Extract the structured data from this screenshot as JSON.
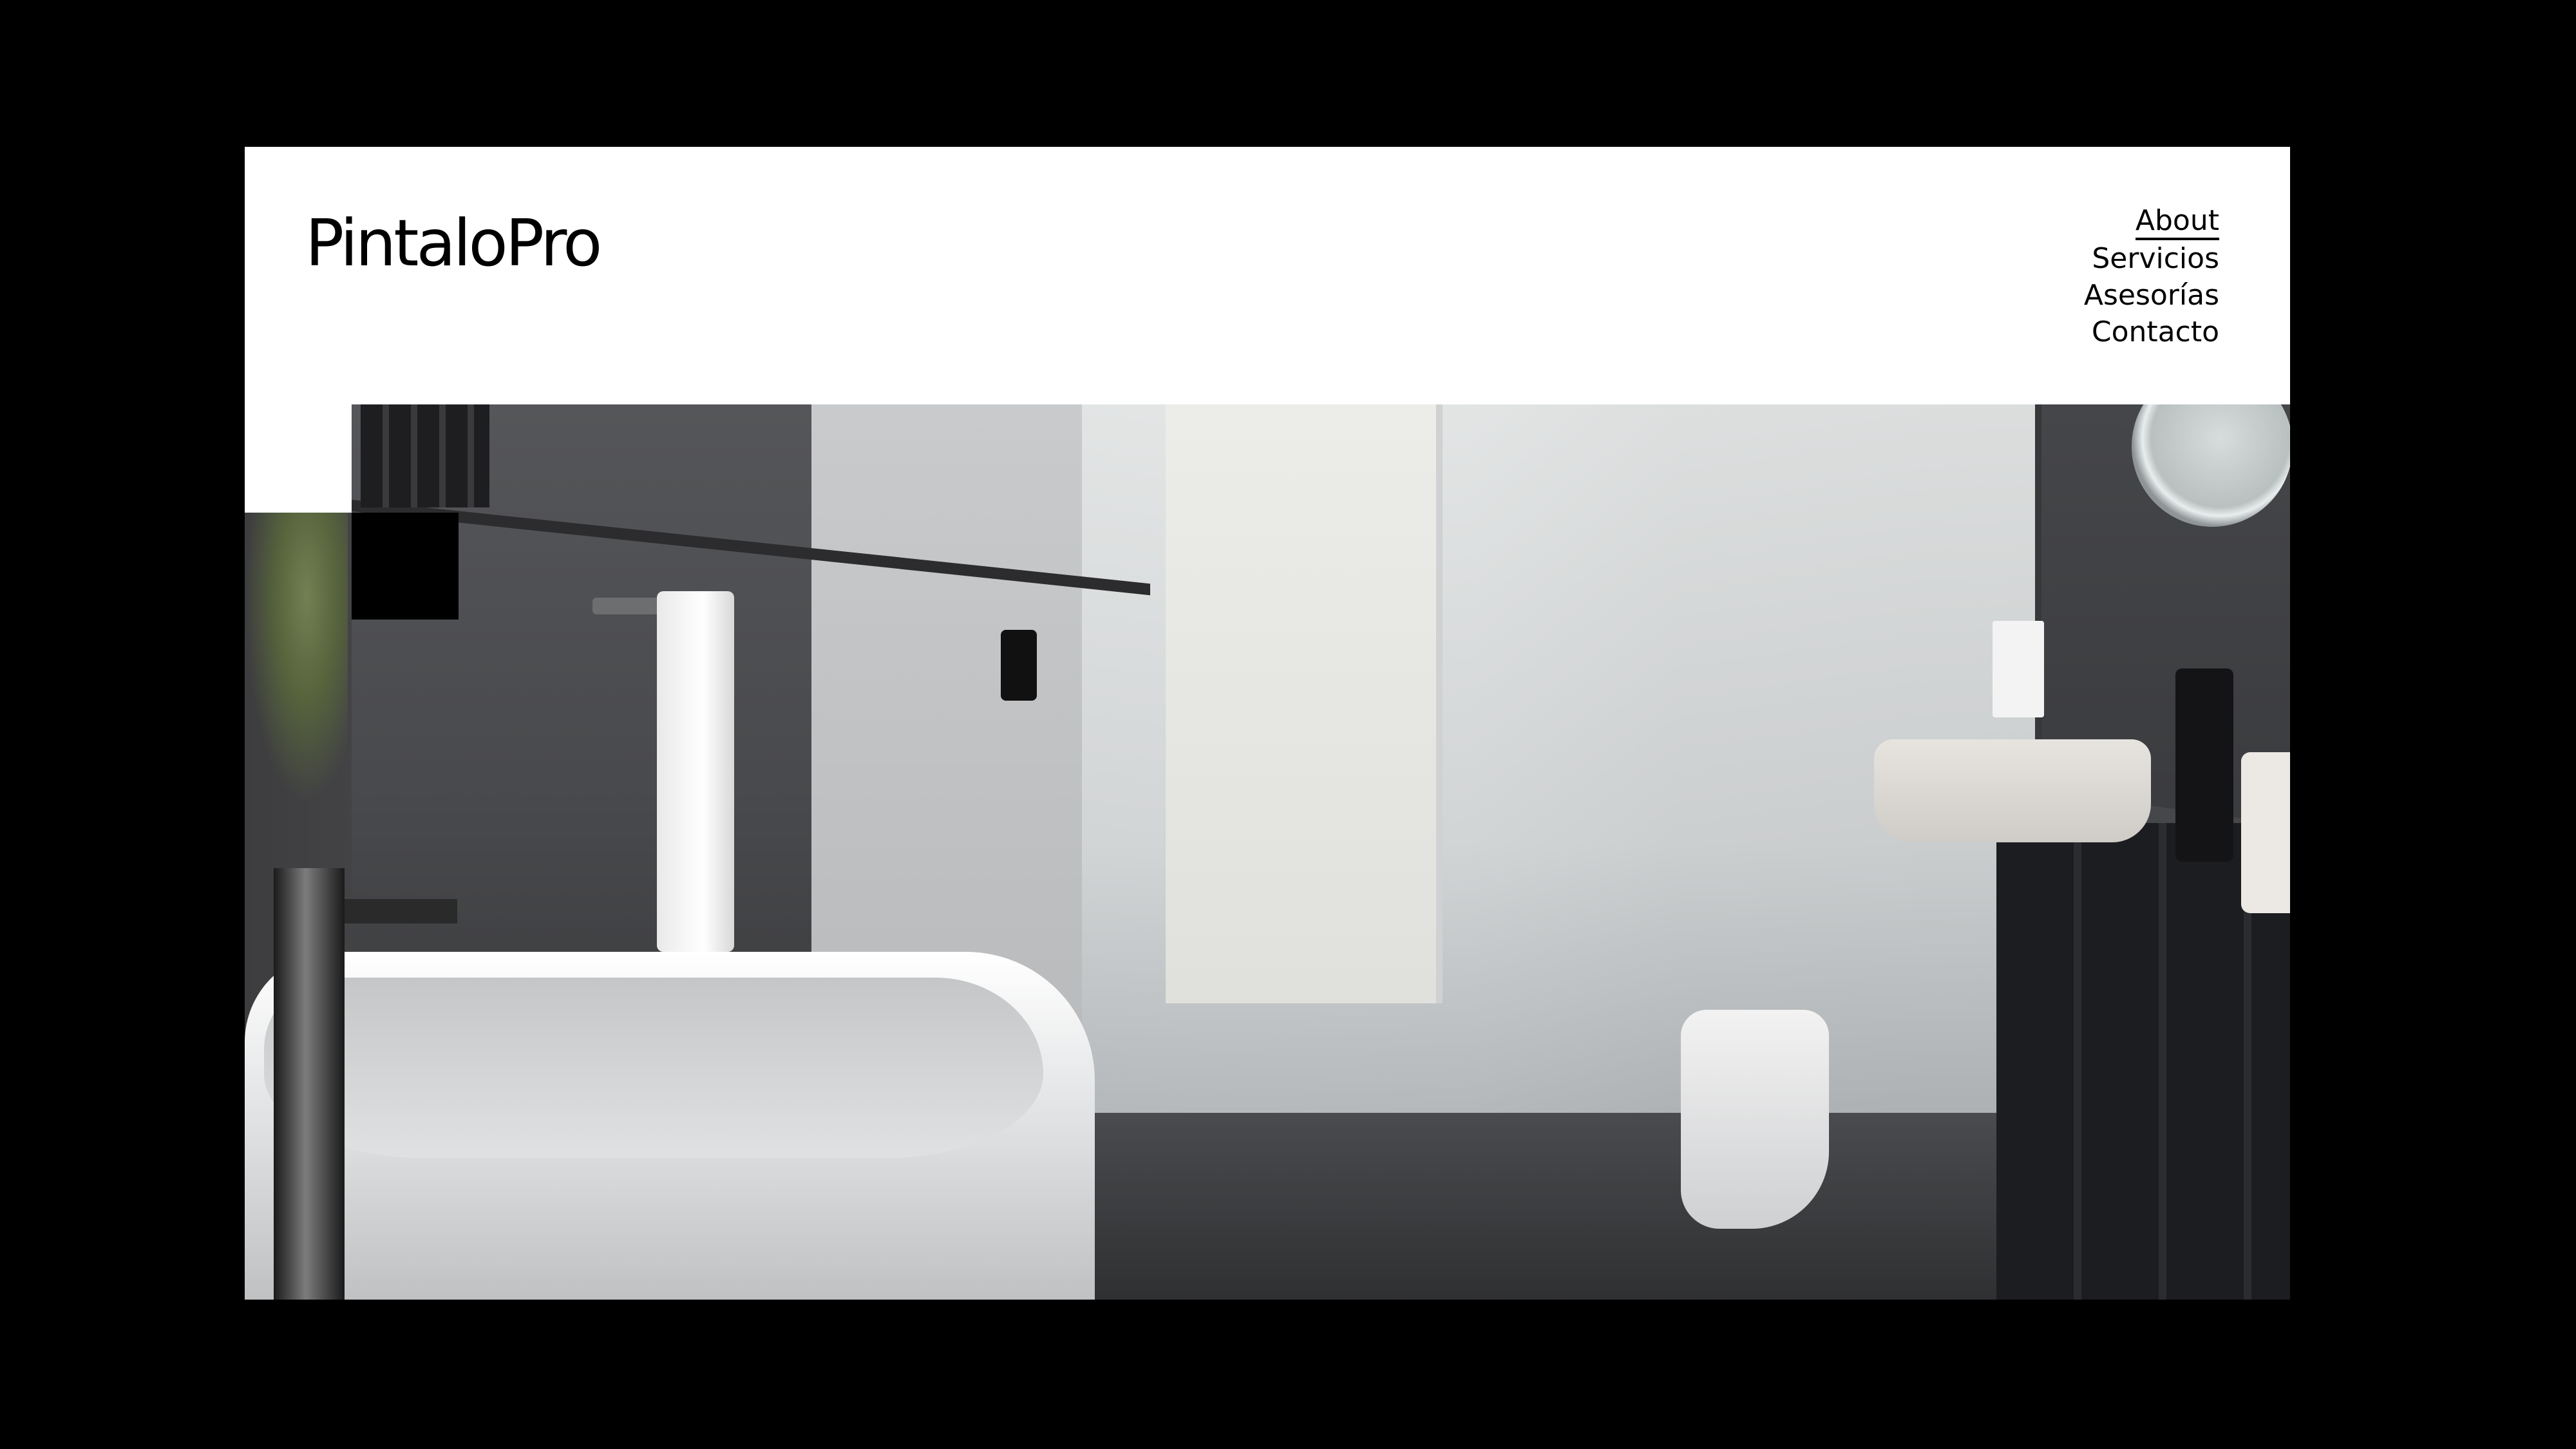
{
  "site": {
    "logo": "PintaloPro",
    "nav": [
      "About",
      "Servicios",
      "Asesorías",
      "Contacto"
    ],
    "active_nav": "About"
  },
  "hero": {
    "image_subject": "bathroom-interior-photo"
  },
  "colors": {
    "frame": "#000000",
    "page": "#ffffff",
    "text": "#000000"
  }
}
